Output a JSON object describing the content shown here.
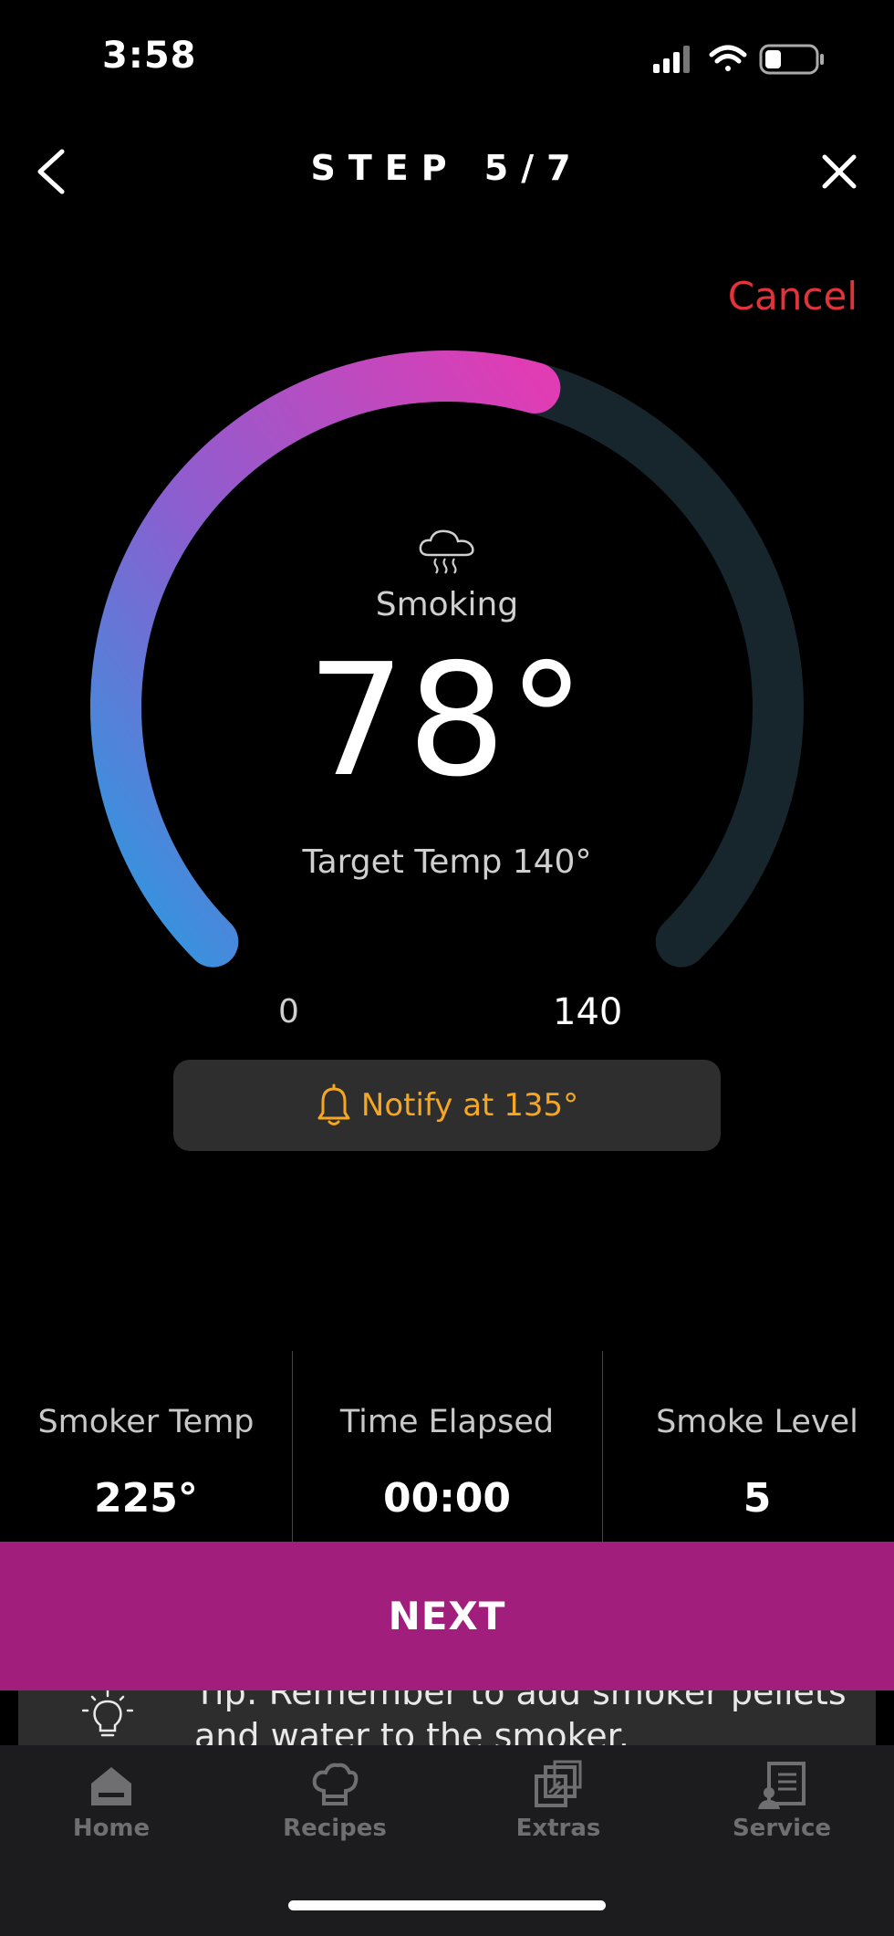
{
  "status_bar": {
    "time": "3:58"
  },
  "header": {
    "title": "STEP 5/7"
  },
  "cancel_label": "Cancel",
  "gauge": {
    "mode_label": "Smoking",
    "current_temp": "78°",
    "target_label": "Target Temp 140°",
    "min_label": "0",
    "max_label": "140",
    "progress_fraction": 0.557,
    "colors": {
      "start": "#2a9be0",
      "mid": "#8a5fd0",
      "end": "#e03cb4",
      "track": "#17252c"
    }
  },
  "notify": {
    "label": "Notify at 135°",
    "color": "#f5a623"
  },
  "stats": [
    {
      "label": "Smoker Temp",
      "value": "225°"
    },
    {
      "label": "Time Elapsed",
      "value": "00:00"
    },
    {
      "label": "Smoke Level",
      "value": "5"
    }
  ],
  "next_button": {
    "label": "NEXT",
    "color": "#a11e7c"
  },
  "tip": {
    "text": "Tip: Remember to add smoker pellets and water to the smoker."
  },
  "tabs": [
    {
      "label": "Home",
      "icon": "home-icon"
    },
    {
      "label": "Recipes",
      "icon": "chef-hat-icon"
    },
    {
      "label": "Extras",
      "icon": "extras-icon"
    },
    {
      "label": "Service",
      "icon": "service-icon"
    }
  ]
}
